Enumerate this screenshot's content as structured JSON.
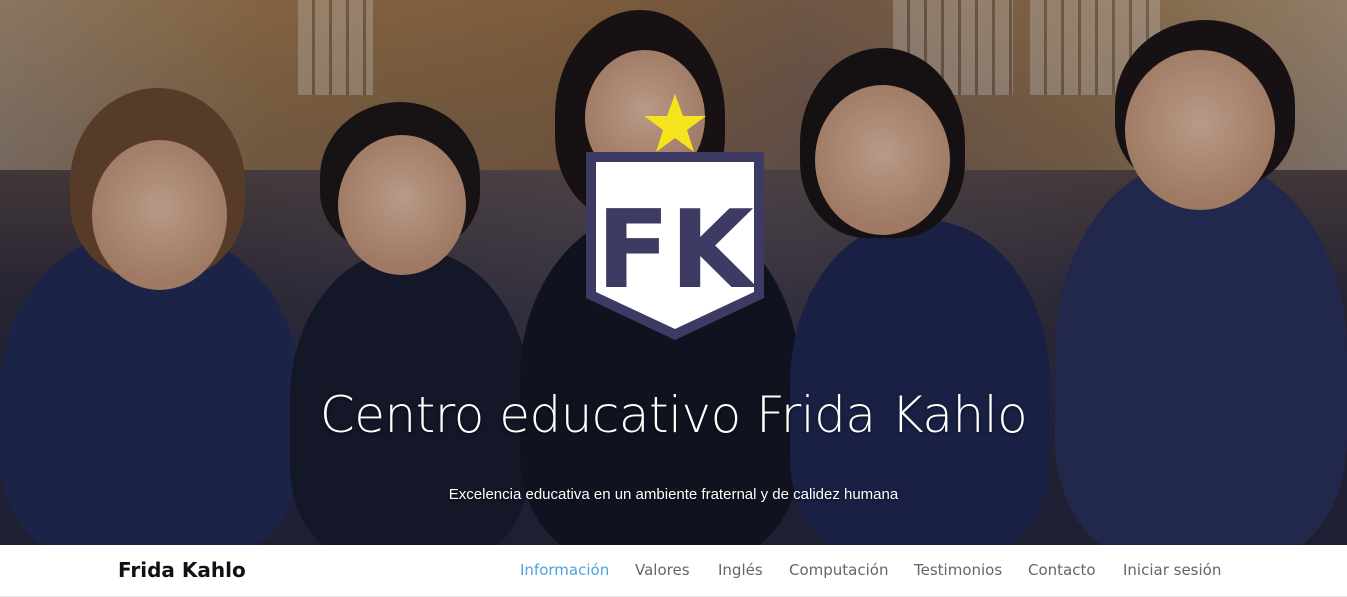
{
  "hero": {
    "logo_letters": "FK",
    "title": "Centro educativo Frida Kahlo",
    "subtitle": "Excelencia educativa en un ambiente fraternal y de calidez humana"
  },
  "navbar": {
    "brand": "Frida Kahlo",
    "links": [
      {
        "label": "Información",
        "active": true
      },
      {
        "label": "Valores",
        "active": false
      },
      {
        "label": "Inglés",
        "active": false
      },
      {
        "label": "Computación",
        "active": false
      },
      {
        "label": "Testimonios",
        "active": false
      },
      {
        "label": "Contacto",
        "active": false
      },
      {
        "label": "Iniciar sesión",
        "active": false
      }
    ]
  },
  "colors": {
    "active_link": "#4aa3e0",
    "logo_star": "#f5e31e",
    "logo_shield": "#3d3a63"
  }
}
